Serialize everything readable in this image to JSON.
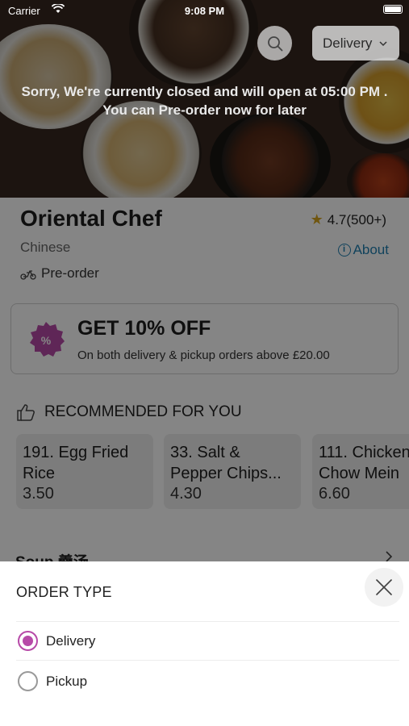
{
  "statusbar": {
    "carrier": "Carrier",
    "time": "9:08 PM"
  },
  "header": {
    "order_type_label": "Delivery"
  },
  "closed_message": {
    "line1": "Sorry, We're currently closed and will open at 05:00 PM .",
    "line2": "You can Pre-order now for later"
  },
  "restaurant": {
    "name": "Oriental Chef",
    "cuisine": "Chinese",
    "rating": "4.7(500+)",
    "about_label": "About",
    "preorder_label": "Pre-order"
  },
  "offer": {
    "badge_symbol": "%",
    "title": "GET 10% OFF",
    "subtitle": "On both delivery & pickup orders above £20.00"
  },
  "recommended": {
    "heading": "RECOMMENDED FOR YOU",
    "items": [
      {
        "name": "191. Egg Fried Rice",
        "price": "3.50"
      },
      {
        "name": "33. Salt & Pepper Chips...",
        "price": "4.30"
      },
      {
        "name": "111. Chicken Chow Mein",
        "price": "6.60"
      }
    ]
  },
  "menu": {
    "first_category": "Soup 羹汤"
  },
  "order_sheet": {
    "title": "ORDER TYPE",
    "options": [
      {
        "label": "Delivery",
        "selected": true
      },
      {
        "label": "Pickup",
        "selected": false
      }
    ]
  },
  "colors": {
    "accent": "#b74aa8",
    "link": "#1f7fb0",
    "star": "#d7a51e"
  }
}
